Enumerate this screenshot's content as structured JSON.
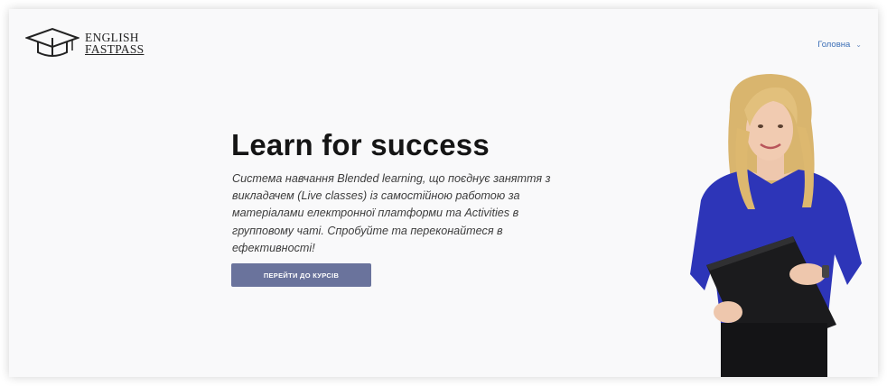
{
  "header": {
    "logo": {
      "line1": "ENGLISH",
      "line2": "FASTPASS",
      "icon": "graduation-cap-icon"
    },
    "nav": {
      "home_label": "Головна",
      "chevron": "⌄"
    }
  },
  "hero": {
    "title": "Learn for success",
    "description_lines": [
      "Система навчання Blended learning, що поєднує заняття з",
      "викладачем (Live classes) із самостійною работою за",
      "матеріалами електронної платформи та Activities в",
      "групповому чаті. Спробуйте та переконайтеся в",
      "ефективності!"
    ],
    "cta_label": "ПЕРЕЙТИ ДО КУРСІВ"
  },
  "colors": {
    "accent_button": "#6a739c",
    "nav_link": "#3c6fb6",
    "background": "#f9f9fa",
    "blouse": "#2d35b8"
  }
}
